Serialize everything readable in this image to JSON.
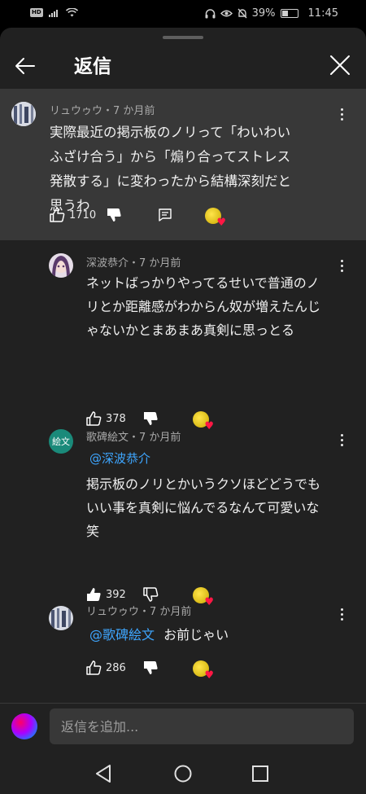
{
  "status_bar": {
    "hd_label": "HD",
    "battery_percent": "39%",
    "battery_level": 0.39,
    "time": "11:45"
  },
  "header": {
    "title": "返信"
  },
  "parent": {
    "author": "リュウゥウ・7 か月前",
    "text": "実際最近の掲示板のノリって「わいわいふざけ合う」から「煽り合ってストレス発散する」に変わったから結構深刻だと思うわ",
    "likes": "1710"
  },
  "replies": [
    {
      "author": "深波恭介・7 か月前",
      "mention": "",
      "text": "ネットばっかりやってるせいで普通のノリとか距離感がわからん奴が増えたんじゃないかとまあまあ真剣に思っとる",
      "likes": "378"
    },
    {
      "author": "歌碑絵文・7 か月前",
      "avatar_text": "絵文",
      "mention": "@深波恭介",
      "text": "掲示板のノリとかいうクソほどどうでもいい事を真剣に悩んでるなんて可愛いな笑",
      "likes": "392"
    },
    {
      "author": "リュウゥウ・7 か月前",
      "mention": "@歌碑絵文",
      "text": "お前じゃい",
      "likes": "286"
    }
  ],
  "compose": {
    "placeholder": "返信を追加..."
  },
  "colors": {
    "sheet_bg": "#212121",
    "highlight_bg": "#383838",
    "mention": "#3ea6ff",
    "heart": "#ff1744",
    "avatar_teal": "#1a8a7a"
  }
}
